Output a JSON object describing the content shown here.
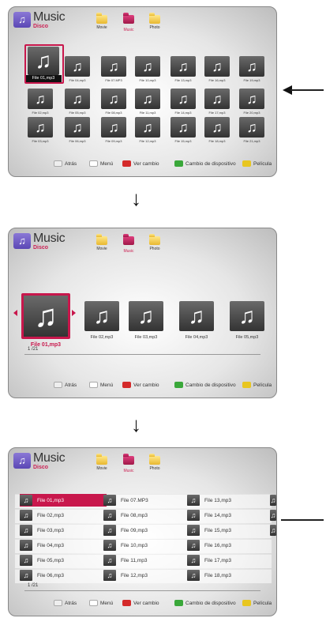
{
  "header": {
    "title": "Music",
    "subtitle": "Disco",
    "music_glyph": "♫",
    "tabs": [
      "Movie",
      "Music",
      "Photo"
    ]
  },
  "grid_screen": {
    "files": [
      "File 01,mp3",
      "File 04,mp3",
      "File 07.MP3",
      "File 10,mp3",
      "File 13,mp3",
      "File 16,mp3",
      "File 19,mp3",
      "File 02,mp3",
      "File 05,mp3",
      "File 08,mp3",
      "File 11,mp3",
      "File 14,mp3",
      "File 17,mp3",
      "File 20,mp3",
      "File 03,mp3",
      "File 06,mp3",
      "File 09,mp3",
      "File 12,mp3",
      "File 15,mp3",
      "File 18,mp3",
      "File 21,mp3"
    ]
  },
  "carousel_screen": {
    "files": [
      "File 01,mp3",
      "File 02,mp3",
      "File 03,mp3",
      "File 04,mp3",
      "File 05,mp3"
    ],
    "page": "1 /21"
  },
  "list_screen": {
    "col1": [
      "File 01,mp3",
      "File 02,mp3",
      "File 03,mp3",
      "File 04,mp3",
      "File 05,mp3",
      "File 06,mp3"
    ],
    "col2": [
      "File 07.MP3",
      "File 08,mp3",
      "File 09,mp3",
      "File 10,mp3",
      "File 11,mp3",
      "File 12,mp3"
    ],
    "col3": [
      "File 13,mp3",
      "File 14,mp3",
      "File 15,mp3",
      "File 16,mp3",
      "File 17,mp3",
      "File 18,mp3"
    ],
    "page": "1 /21"
  },
  "footer": {
    "back": "Atrás",
    "menu": "Menú",
    "red": "Ver cambio",
    "green": "Cambio de dispositivo",
    "yellow": "Película"
  },
  "colors": {
    "accent": "#c8174c",
    "red_key": "#d42a2a",
    "green_key": "#3aa83a",
    "yellow_key": "#e8c620"
  }
}
